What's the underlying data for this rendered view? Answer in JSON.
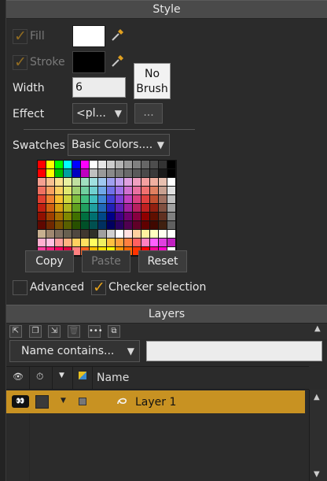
{
  "style": {
    "title": "Style",
    "fill_label": "Fill",
    "stroke_label": "Stroke",
    "fill_color": "#ffffff",
    "stroke_color": "#000000",
    "no_brush_line1": "No",
    "no_brush_line2": "Brush",
    "width_label": "Width",
    "width_value": "6",
    "effect_label": "Effect",
    "effect_value": "<pl...",
    "effect_more": "...",
    "swatches_label": "Swatches",
    "swatches_value": "Basic Colors....",
    "copy_label": "Copy",
    "paste_label": "Paste",
    "reset_label": "Reset",
    "advanced_label": "Advanced",
    "checker_label": "Checker selection",
    "palette": [
      [
        "#ff0000",
        "#ffff00",
        "#00ff00",
        "#00ffff",
        "#0000ff",
        "#ff00ff",
        "#ffffff",
        "#e6e6e6",
        "#cccccc",
        "#b3b3b3",
        "#999999",
        "#808080",
        "#666666",
        "#4d4d4d",
        "#333333",
        "#000000"
      ],
      [
        "#ff0000",
        "#ffff00",
        "#00c000",
        "#00a0a0",
        "#0000c0",
        "#c000c0",
        "#c0c0c0",
        "#9a9a9a",
        "#8a8a8a",
        "#7a7a7a",
        "#6a6a6a",
        "#5a5a5a",
        "#4a4a4a",
        "#3a3a3a",
        "#1a1a1a",
        "#000000"
      ],
      [
        "#f4a090",
        "#f8c090",
        "#fce090",
        "#e8f0a0",
        "#c0e0a0",
        "#a0e0c0",
        "#a0e0e0",
        "#a0c8f0",
        "#a0a0f0",
        "#c0a0f0",
        "#e0a0e0",
        "#f0a0c0",
        "#f4a0a0",
        "#f0b0a0",
        "#e8c0b0",
        "#ffffff"
      ],
      [
        "#f07060",
        "#f8a060",
        "#fcd060",
        "#e0e870",
        "#a0d070",
        "#70d0a0",
        "#70d0d0",
        "#70a8e8",
        "#7070e8",
        "#a070e8",
        "#d070d0",
        "#e870a0",
        "#f07070",
        "#e08060",
        "#c8a090",
        "#e0e0e0"
      ],
      [
        "#e04030",
        "#f08030",
        "#f8c030",
        "#d0d840",
        "#80c040",
        "#40c080",
        "#40c0c0",
        "#4088d8",
        "#4040d8",
        "#8040d8",
        "#c040c0",
        "#d84080",
        "#e04040",
        "#c05030",
        "#a07060",
        "#c0c0c0"
      ],
      [
        "#c02010",
        "#d06010",
        "#d8a010",
        "#b0b820",
        "#60a020",
        "#20a060",
        "#20a0a0",
        "#2068b8",
        "#2020b8",
        "#6020b8",
        "#a020a0",
        "#b82060",
        "#c02020",
        "#902010",
        "#805040",
        "#a0a0a0"
      ],
      [
        "#901000",
        "#a04000",
        "#a87000",
        "#808800",
        "#407000",
        "#007040",
        "#007070",
        "#004888",
        "#000088",
        "#400088",
        "#700070",
        "#880040",
        "#900000",
        "#601000",
        "#603020",
        "#808080"
      ],
      [
        "#600800",
        "#702800",
        "#785000",
        "#586000",
        "#285000",
        "#005028",
        "#005050",
        "#003060",
        "#000060",
        "#280060",
        "#500050",
        "#600028",
        "#600000",
        "#400800",
        "#402010",
        "#606060"
      ],
      [
        "#c8b090",
        "#a08870",
        "#807060",
        "#686050",
        "#504840",
        "#403830",
        "#303028",
        "#a0a0a0",
        "#d0d0d0",
        "#ffffff",
        "#ffe0e0",
        "#ffd0a0",
        "#fff0a0",
        "#ffffc0",
        "#fffff0",
        "#ffffff"
      ],
      [
        "#ffb0d0",
        "#ffc0e0",
        "#ffa0a0",
        "#ffb080",
        "#ffd060",
        "#ffe060",
        "#ffff60",
        "#f0f060",
        "#ffc040",
        "#ffa040",
        "#ff8040",
        "#ff6060",
        "#ff80c0",
        "#ff60ff",
        "#e040e0",
        "#c020c0"
      ],
      [
        "#ff40a0",
        "#ff2080",
        "#ff0060",
        "#e00040",
        "#ff8080",
        "#ff6020",
        "#ffc000",
        "#ffe000",
        "#ffff00",
        "#ff9900",
        "#ff6600",
        "#ff3300",
        "#ff0000",
        "#ff0099",
        "#ff00cc",
        "#ffffff"
      ]
    ]
  },
  "layers": {
    "title": "Layers",
    "filter_label": "Name contains...",
    "filter_value": "",
    "name_col": "Name",
    "layer1_name": "Layer 1",
    "accent": "#c89222"
  }
}
